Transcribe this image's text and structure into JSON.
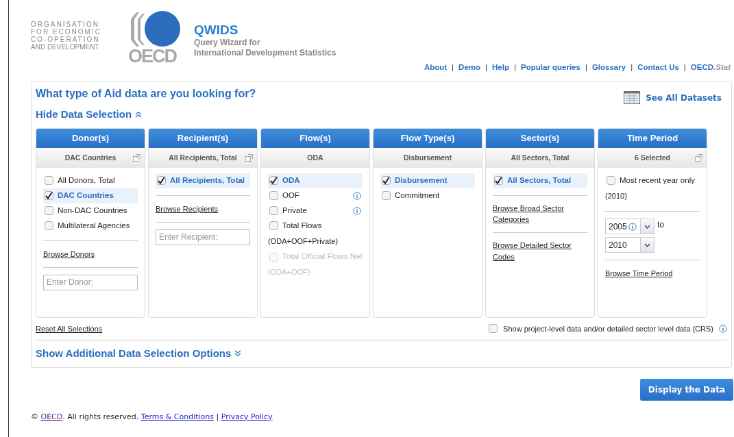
{
  "header": {
    "org_name": [
      "ORGANISATION",
      "FOR ECONOMIC",
      "CO-OPERATION",
      "AND DEVELOPMENT"
    ],
    "logo_text": "OECD",
    "app_title": "QWIDS",
    "app_subtitle": [
      "Query Wizard for",
      "International Development Statistics"
    ]
  },
  "nav_links": [
    {
      "kind": "link",
      "label": "About"
    },
    {
      "kind": "separator",
      "label": "|"
    },
    {
      "kind": "link",
      "label": "Demo"
    },
    {
      "kind": "separator",
      "label": "|"
    },
    {
      "kind": "link",
      "label": "Help"
    },
    {
      "kind": "separator",
      "label": "|"
    },
    {
      "kind": "link",
      "label": "Popular queries"
    },
    {
      "kind": "separator",
      "label": "|"
    },
    {
      "kind": "link",
      "label": "Glossary"
    },
    {
      "kind": "separator",
      "label": "|"
    },
    {
      "kind": "link",
      "label": "Contact Us"
    },
    {
      "kind": "separator",
      "label": "|"
    },
    {
      "kind": "link",
      "label": "OECD",
      "suffix": ".Stat"
    }
  ],
  "main": {
    "question": "What type of Aid data are you looking for?",
    "see_all": "See All Datasets",
    "hide_selection": "Hide Data Selection",
    "panels": [
      {
        "title": "Donor(s)",
        "summary": "DAC Countries",
        "popout": true,
        "items": [
          {
            "kind": "checkbox",
            "label": "All Donors, Total",
            "checked": false,
            "disabled": false,
            "info": false
          },
          {
            "kind": "checkbox",
            "label": "DAC Countries",
            "checked": true,
            "disabled": false,
            "info": false
          },
          {
            "kind": "checkbox",
            "label": "Non-DAC Countries",
            "checked": false,
            "disabled": false,
            "info": false
          },
          {
            "kind": "checkbox",
            "label": "Multilateral Agencies",
            "checked": false,
            "disabled": false,
            "info": false
          },
          {
            "kind": "divider"
          },
          {
            "kind": "link",
            "label": "Browse Donors"
          },
          {
            "kind": "divider"
          },
          {
            "kind": "field",
            "placeholder": "Enter Donor:"
          }
        ]
      },
      {
        "title": "Recipient(s)",
        "summary": "All Recipients, Total",
        "popout": true,
        "items": [
          {
            "kind": "checkbox",
            "label": "All Recipients, Total",
            "checked": true,
            "disabled": false,
            "info": false
          },
          {
            "kind": "divider"
          },
          {
            "kind": "link",
            "label": "Browse Recipients"
          },
          {
            "kind": "divider"
          },
          {
            "kind": "field",
            "placeholder": "Enter Recipient:"
          }
        ]
      },
      {
        "title": "Flow(s)",
        "summary": "ODA",
        "popout": false,
        "items": [
          {
            "kind": "checkbox",
            "label": "ODA",
            "checked": true,
            "disabled": false,
            "info": false
          },
          {
            "kind": "checkbox",
            "label": "OOF",
            "checked": false,
            "disabled": false,
            "info": true
          },
          {
            "kind": "checkbox",
            "label": "Private",
            "checked": false,
            "disabled": false,
            "info": true
          },
          {
            "kind": "checkbox",
            "label": "Total Flows",
            "note": "(ODA+OOF+Private)",
            "checked": false,
            "disabled": false,
            "info": false
          },
          {
            "kind": "checkbox",
            "label": "Total Official Flows Net",
            "note": "(ODA+OOF)",
            "checked": false,
            "disabled": true,
            "info": false
          }
        ]
      },
      {
        "title": "Flow Type(s)",
        "summary": "Disbursement",
        "popout": false,
        "items": [
          {
            "kind": "checkbox",
            "label": "Disbursement",
            "checked": true,
            "disabled": false,
            "info": false
          },
          {
            "kind": "checkbox",
            "label": "Commitment",
            "checked": false,
            "disabled": false,
            "info": false
          }
        ]
      },
      {
        "title": "Sector(s)",
        "summary": "All Sectors, Total",
        "popout": false,
        "items": [
          {
            "kind": "checkbox",
            "label": "All Sectors, Total",
            "checked": true,
            "disabled": false,
            "info": false
          },
          {
            "kind": "divider"
          },
          {
            "kind": "link",
            "label": "Browse Broad Sector Categories"
          },
          {
            "kind": "divider"
          },
          {
            "kind": "link",
            "label": "Browse Detailed Sector Codes"
          }
        ]
      },
      {
        "title": "Time Period",
        "summary": "6 Selected",
        "popout": true,
        "items": [
          {
            "kind": "checkbox",
            "label": "Most recent year only",
            "note": "(2010)",
            "checked": false,
            "disabled": false,
            "info": false
          },
          {
            "kind": "divider"
          },
          {
            "kind": "year_range",
            "from": "2005",
            "to": "2010",
            "joiner": "to"
          },
          {
            "kind": "divider"
          },
          {
            "kind": "link",
            "label": "Browse Time Period"
          }
        ]
      }
    ],
    "reset": "Reset All Selections",
    "crs_option": {
      "label": "Show project-level data and/or detailed sector level data (CRS)",
      "checked": false
    },
    "show_additional": "Show Additional Data Selection Options"
  },
  "display_button": "Display the Data",
  "footer": {
    "copyright": "©",
    "owner_link": "OECD",
    "rights": ". All rights reserved.",
    "terms": "Terms & Conditions",
    "separator": "|",
    "privacy": "Privacy Policy"
  }
}
